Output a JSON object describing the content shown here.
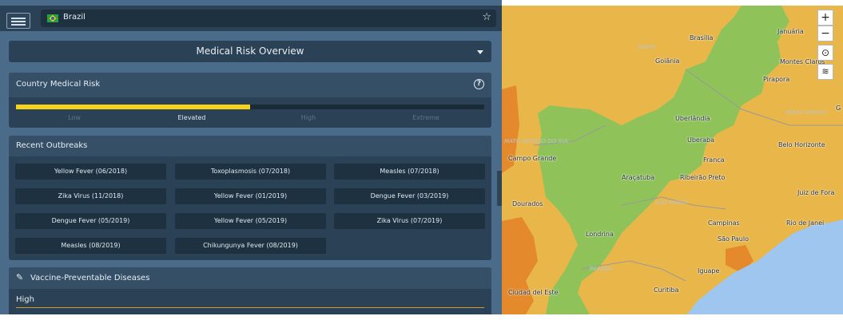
{
  "header": {
    "country": "Brazil"
  },
  "section_dropdown": {
    "title": "Medical Risk Overview"
  },
  "risk": {
    "title": "Country Medical Risk",
    "level_fraction": 0.5,
    "levels": [
      "Low",
      "Elevated",
      "High",
      "Extreme"
    ],
    "active_level": "Elevated"
  },
  "outbreaks": {
    "title": "Recent Outbreaks",
    "items": [
      "Yellow Fever (06/2018)",
      "Toxoplasmosis (07/2018)",
      "Measles (07/2018)",
      "Zika Virus (11/2018)",
      "Yellow Fever (01/2019)",
      "Dengue Fever (03/2019)",
      "Dengue Fever (05/2019)",
      "Yellow Fever (05/2019)",
      "Zika Virus (07/2019)",
      "Measles (08/2019)",
      "Chikungunya Fever (08/2019)"
    ]
  },
  "vaccine": {
    "title": "Vaccine-Preventable Diseases",
    "level": "High"
  },
  "map": {
    "controls": {
      "zoom_in": "+",
      "zoom_out": "−"
    },
    "cities": [
      "Brasília",
      "Goiânia",
      "Januária",
      "Montes Claros",
      "Pirapora",
      "Uberlândia",
      "Uberaba",
      "Franca",
      "Ribeirão Preto",
      "Belo Horizonte",
      "Campo Grande",
      "Araçatuba",
      "Juiz de Fora",
      "Dourados",
      "Campinas",
      "São Paulo",
      "Rio de Janei",
      "Londrina",
      "Curitiba",
      "Ciudad del Este",
      "Iguape",
      "G"
    ],
    "regions": [
      "GOIÁS",
      "MINAS GERAIS",
      "MATO GROSSO DO SUL",
      "SÃO PAULO",
      "PARANÁ"
    ],
    "colors": {
      "elevated": "#e9b64a",
      "low": "#8fc35a",
      "high": "#e58a2c",
      "water": "#9fc6ee"
    }
  }
}
